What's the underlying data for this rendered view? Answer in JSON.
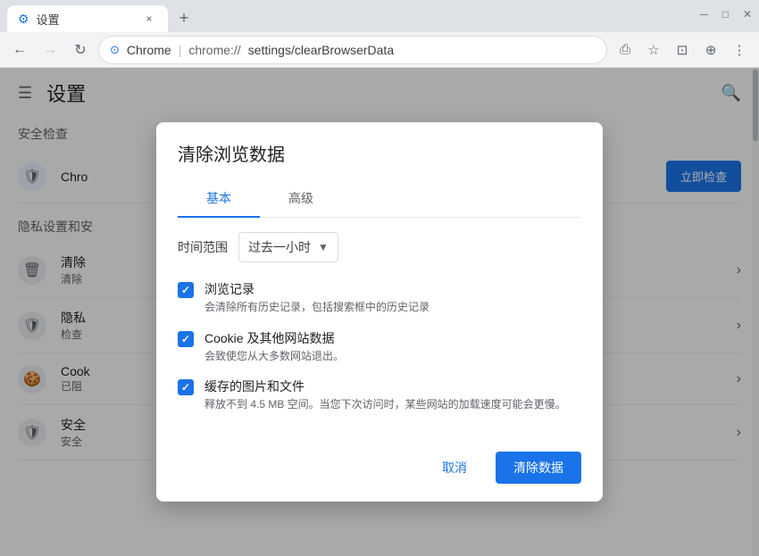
{
  "browser": {
    "tab_label": "设置",
    "tab_close": "×",
    "new_tab_icon": "+",
    "minimize_icon": "─",
    "restore_icon": "□",
    "close_icon": "✕",
    "chevron_down": "∨"
  },
  "toolbar": {
    "back_icon": "←",
    "forward_icon": "→",
    "refresh_icon": "↻",
    "site_icon": "⊙",
    "url_brand": "Chrome",
    "url_separator": "|",
    "url_scheme": "chrome://",
    "url_path": "settings/clearBrowserData",
    "share_icon": "⎙",
    "star_icon": "☆",
    "reader_icon": "⊡",
    "profile_icon": "⊕",
    "menu_icon": "⋮"
  },
  "settings": {
    "hamburger": "☰",
    "title": "设置",
    "search_icon": "🔍",
    "safe_check_title": "安全检查",
    "safe_check_item": "Chro",
    "safe_check_btn": "立即检查",
    "privacy_title": "隐私设置和安",
    "privacy_items": [
      {
        "icon": "🗑",
        "title": "清除",
        "sub": "清除"
      },
      {
        "icon": "🛡",
        "title": "隐私",
        "sub": "检查"
      },
      {
        "icon": "🍪",
        "title": "Cook",
        "sub": "已阻"
      },
      {
        "icon": "🛡",
        "title": "安全",
        "sub": "安全"
      }
    ]
  },
  "dialog": {
    "title": "清除浏览数据",
    "tab_basic": "基本",
    "tab_advanced": "高级",
    "time_range_label": "时间范围",
    "time_range_value": "过去一小时",
    "checkboxes": [
      {
        "title": "浏览记录",
        "desc": "会清除所有历史记录，包括搜索框中的历史记录",
        "checked": true
      },
      {
        "title": "Cookie 及其他网站数据",
        "desc": "会致使您从大多数网站退出。",
        "checked": true
      },
      {
        "title": "缓存的图片和文件",
        "desc": "释放不到 4.5 MB 空间。当您下次访问时，某些网站的加载速度可能会更慢。",
        "checked": true
      }
    ],
    "btn_cancel": "取消",
    "btn_clear": "清除数据"
  }
}
